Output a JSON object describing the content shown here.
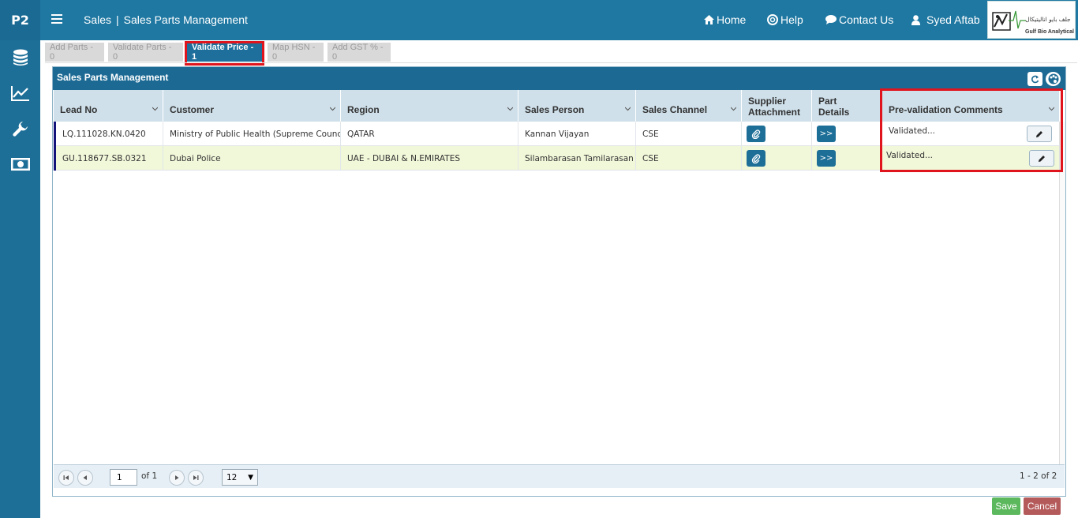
{
  "sidebar": {
    "brand": "P2",
    "icons": [
      "database-icon",
      "chart-icon",
      "wrench-icon",
      "money-icon"
    ]
  },
  "header": {
    "module": "Sales",
    "page": "Sales Parts Management",
    "nav": {
      "home": "Home",
      "help": "Help",
      "contact": "Contact Us",
      "user": "Syed Aftab"
    },
    "logo": {
      "arabic": "جلف بايو اناليتيكال",
      "english": "Gulf Bio Analytical"
    }
  },
  "tabs": [
    {
      "label": "Add Parts - 0",
      "active": false
    },
    {
      "label": "Validate Parts - 0",
      "active": false
    },
    {
      "label": "Validate Price - 1",
      "active": true
    },
    {
      "label": "Map HSN - 0",
      "active": false
    },
    {
      "label": "Add GST % - 0",
      "active": false
    }
  ],
  "panel": {
    "title": "Sales Parts Management",
    "columns": {
      "lead_no": "Lead No",
      "customer": "Customer",
      "region": "Region",
      "sales_person": "Sales Person",
      "sales_channel": "Sales Channel",
      "supplier_1": "Supplier",
      "supplier_2": "Attachment",
      "part_1": "Part",
      "part_2": "Details",
      "comments": "Pre-validation Comments"
    },
    "rows": [
      {
        "lead_no": "LQ.111028.KN.0420",
        "customer": "Ministry of Public Health (Supreme Council...",
        "region": "QATAR",
        "sales_person": "Kannan Vijayan",
        "sales_channel": "CSE",
        "details_label": ">>",
        "comment": "Validated..."
      },
      {
        "lead_no": "GU.118677.SB.0321",
        "customer": "Dubai Police",
        "region": "UAE - DUBAI & N.EMIRATES",
        "sales_person": "Silambarasan Tamilarasan",
        "sales_channel": "CSE",
        "details_label": ">>",
        "comment": "Validated..."
      }
    ]
  },
  "pager": {
    "page": "1",
    "of_label": "of 1",
    "page_size": "12",
    "range": "1 - 2 of 2"
  },
  "actions": {
    "save": "Save",
    "cancel": "Cancel"
  },
  "colors": {
    "header": "#1f78a2",
    "sidebar": "#1d6f98",
    "highlight": "#e0141c",
    "save": "#5cb85c",
    "cancel": "#b55a5a"
  }
}
